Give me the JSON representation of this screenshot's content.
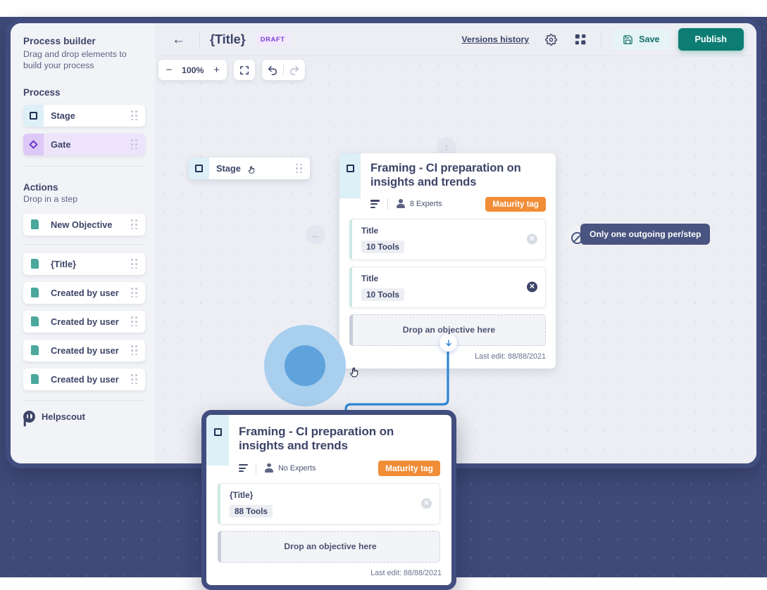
{
  "sidebar": {
    "title": "Process builder",
    "subtitle": "Drag and drop elements to build your process",
    "process_section": "Process",
    "process_items": [
      {
        "label": "Stage",
        "icon": "square-icon"
      },
      {
        "label": "Gate",
        "icon": "diamond-icon"
      }
    ],
    "actions_section": "Actions",
    "actions_subtitle": "Drop in a step",
    "action_items": [
      {
        "label": "New Objective",
        "icon": "document-icon"
      },
      {
        "label": "{Title}",
        "icon": "document-icon"
      },
      {
        "label": "Created by user",
        "icon": "document-icon"
      },
      {
        "label": "Created by user",
        "icon": "document-icon"
      },
      {
        "label": "Created by user",
        "icon": "document-icon"
      },
      {
        "label": "Created by user",
        "icon": "document-icon"
      }
    ],
    "helpscout": "Helpscout"
  },
  "topbar": {
    "back_icon": "←",
    "title": "{Title}",
    "status_badge": "DRAFT",
    "versions_history": "Versions history",
    "settings_icon": "gear-icon",
    "grid_icon": "grid-icon",
    "save_label": "Save",
    "publish_label": "Publish",
    "accent_color": "#0d7d74",
    "draft_color": "#7a3fd6"
  },
  "zoom_toolbar": {
    "minus": "−",
    "level": "100%",
    "plus": "+",
    "fit_icon": "fullscreen-icon",
    "undo_icon": "undo-icon",
    "redo_icon": "redo-icon"
  },
  "canvas": {
    "stage_node": {
      "label": "Stage",
      "icon": "square-icon",
      "cursor": "hand-cursor"
    },
    "tooltip": "Only one outgoing per/step",
    "handles": {
      "up": "↑",
      "left": "←",
      "right": "→",
      "down": "↓"
    }
  },
  "step_card": {
    "title": "Framing - CI preparation on insights and trends",
    "experts": "8 Experts",
    "tag": "Maturity tag",
    "tag_color": "#f08d36",
    "objectives": [
      {
        "title": "Title",
        "pill": "10 Tools",
        "close_active": false
      },
      {
        "title": "Title",
        "pill": "10 Tools",
        "close_active": true
      }
    ],
    "dropzone": "Drop an objective here",
    "last_edit": "Last edit: 88/88/2021"
  },
  "dragged_card": {
    "title": "Framing - CI preparation on insights and trends",
    "experts": "No Experts",
    "tag": "Maturity tag",
    "objectives": [
      {
        "title": "{Title}",
        "pill": "88 Tools",
        "close_active": false
      }
    ],
    "dropzone": "Drop an objective here",
    "last_edit": "Last edit: 88/88/2021"
  }
}
